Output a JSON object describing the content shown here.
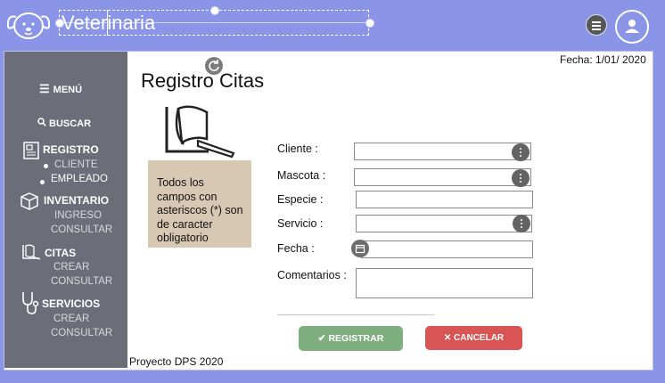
{
  "header": {
    "title": "Veterinaria"
  },
  "sidebar": {
    "menu_label": "MENÚ",
    "search_label": "BUSCAR",
    "sections": [
      {
        "title": "REGISTRO",
        "icon": "id-card-icon",
        "items": [
          "CLIENTE",
          "EMPLEADO"
        ]
      },
      {
        "title": "INVENTARIO",
        "icon": "box-icon",
        "items": [
          "INGRESO",
          "CONSULTAR"
        ]
      },
      {
        "title": "CITAS",
        "icon": "note-icon",
        "items": [
          "CREAR",
          "CONSULTAR"
        ]
      },
      {
        "title": "SERVICIOS",
        "icon": "stethoscope-icon",
        "items": [
          "CREAR",
          "CONSULTAR"
        ]
      }
    ]
  },
  "main": {
    "date": "Fecha: 1/01/ 2020",
    "title": "Registro Citas",
    "note": "Todos los campos con asteriscos (*) son de caracter obligatorio"
  },
  "form": {
    "fields": [
      {
        "label": "Cliente :",
        "value": ""
      },
      {
        "label": "Mascota :",
        "value": ""
      },
      {
        "label": "Especie :",
        "value": ""
      },
      {
        "label": "Servicio :",
        "value": ""
      },
      {
        "label": "Fecha :",
        "value": ""
      },
      {
        "label": "Comentarios :",
        "value": ""
      }
    ],
    "submit_label": "REGISTRAR",
    "cancel_label": "CANCELAR"
  },
  "footer": {
    "text": "Proyecto DPS 2020"
  },
  "colors": {
    "header_bg": "#8b95e8",
    "sidebar_bg": "#6b6d78",
    "submit": "#7fae7f",
    "cancel": "#d95454",
    "note_bg": "#d8c8b3"
  }
}
